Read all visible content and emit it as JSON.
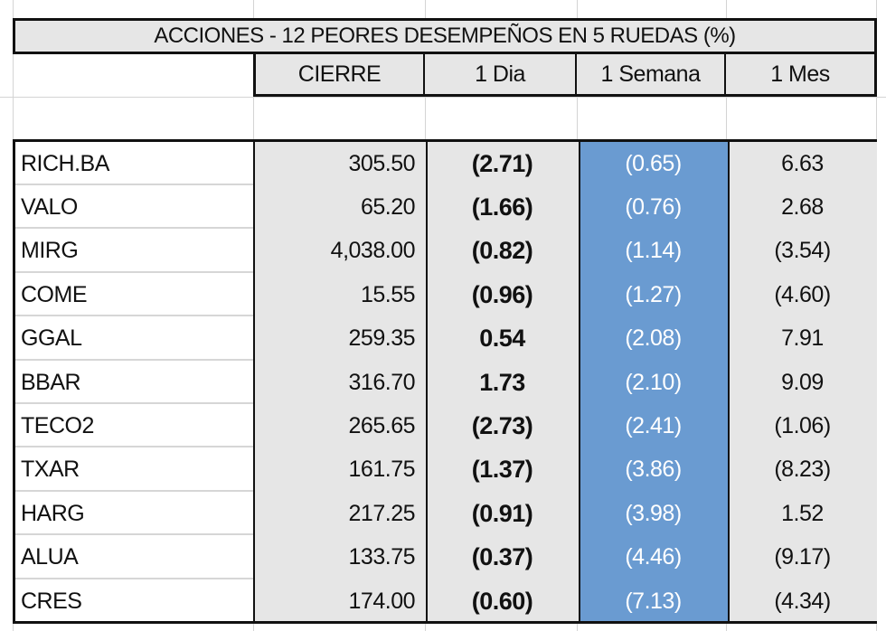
{
  "title": "ACCIONES   - 12 PEORES DESEMPEÑOS EN 5 RUEDAS (%)",
  "columns": [
    "",
    "CIERRE",
    "1 Dia",
    "1 Semana",
    "1 Mes"
  ],
  "colors": {
    "header_bg": "#e6e6e6",
    "highlight_column_bg": "#6a9bd1",
    "highlight_text": "#ffffff",
    "border": "#111111"
  },
  "rows": [
    {
      "ticker": "RICH.BA",
      "cierre": "305.50",
      "dia": "(2.71)",
      "semana": "(0.65)",
      "mes": "6.63"
    },
    {
      "ticker": "VALO",
      "cierre": "65.20",
      "dia": "(1.66)",
      "semana": "(0.76)",
      "mes": "2.68"
    },
    {
      "ticker": "MIRG",
      "cierre": "4,038.00",
      "dia": "(0.82)",
      "semana": "(1.14)",
      "mes": "(3.54)"
    },
    {
      "ticker": "COME",
      "cierre": "15.55",
      "dia": "(0.96)",
      "semana": "(1.27)",
      "mes": "(4.60)"
    },
    {
      "ticker": "GGAL",
      "cierre": "259.35",
      "dia": "0.54",
      "semana": "(2.08)",
      "mes": "7.91"
    },
    {
      "ticker": "BBAR",
      "cierre": "316.70",
      "dia": "1.73",
      "semana": "(2.10)",
      "mes": "9.09"
    },
    {
      "ticker": "TECO2",
      "cierre": "265.65",
      "dia": "(2.73)",
      "semana": "(2.41)",
      "mes": "(1.06)"
    },
    {
      "ticker": "TXAR",
      "cierre": "161.75",
      "dia": "(1.37)",
      "semana": "(3.86)",
      "mes": "(8.23)"
    },
    {
      "ticker": "HARG",
      "cierre": "217.25",
      "dia": "(0.91)",
      "semana": "(3.98)",
      "mes": "1.52"
    },
    {
      "ticker": "ALUA",
      "cierre": "133.75",
      "dia": "(0.37)",
      "semana": "(4.46)",
      "mes": "(9.17)"
    },
    {
      "ticker": "CRES",
      "cierre": "174.00",
      "dia": "(0.60)",
      "semana": "(7.13)",
      "mes": "(4.34)"
    }
  ]
}
